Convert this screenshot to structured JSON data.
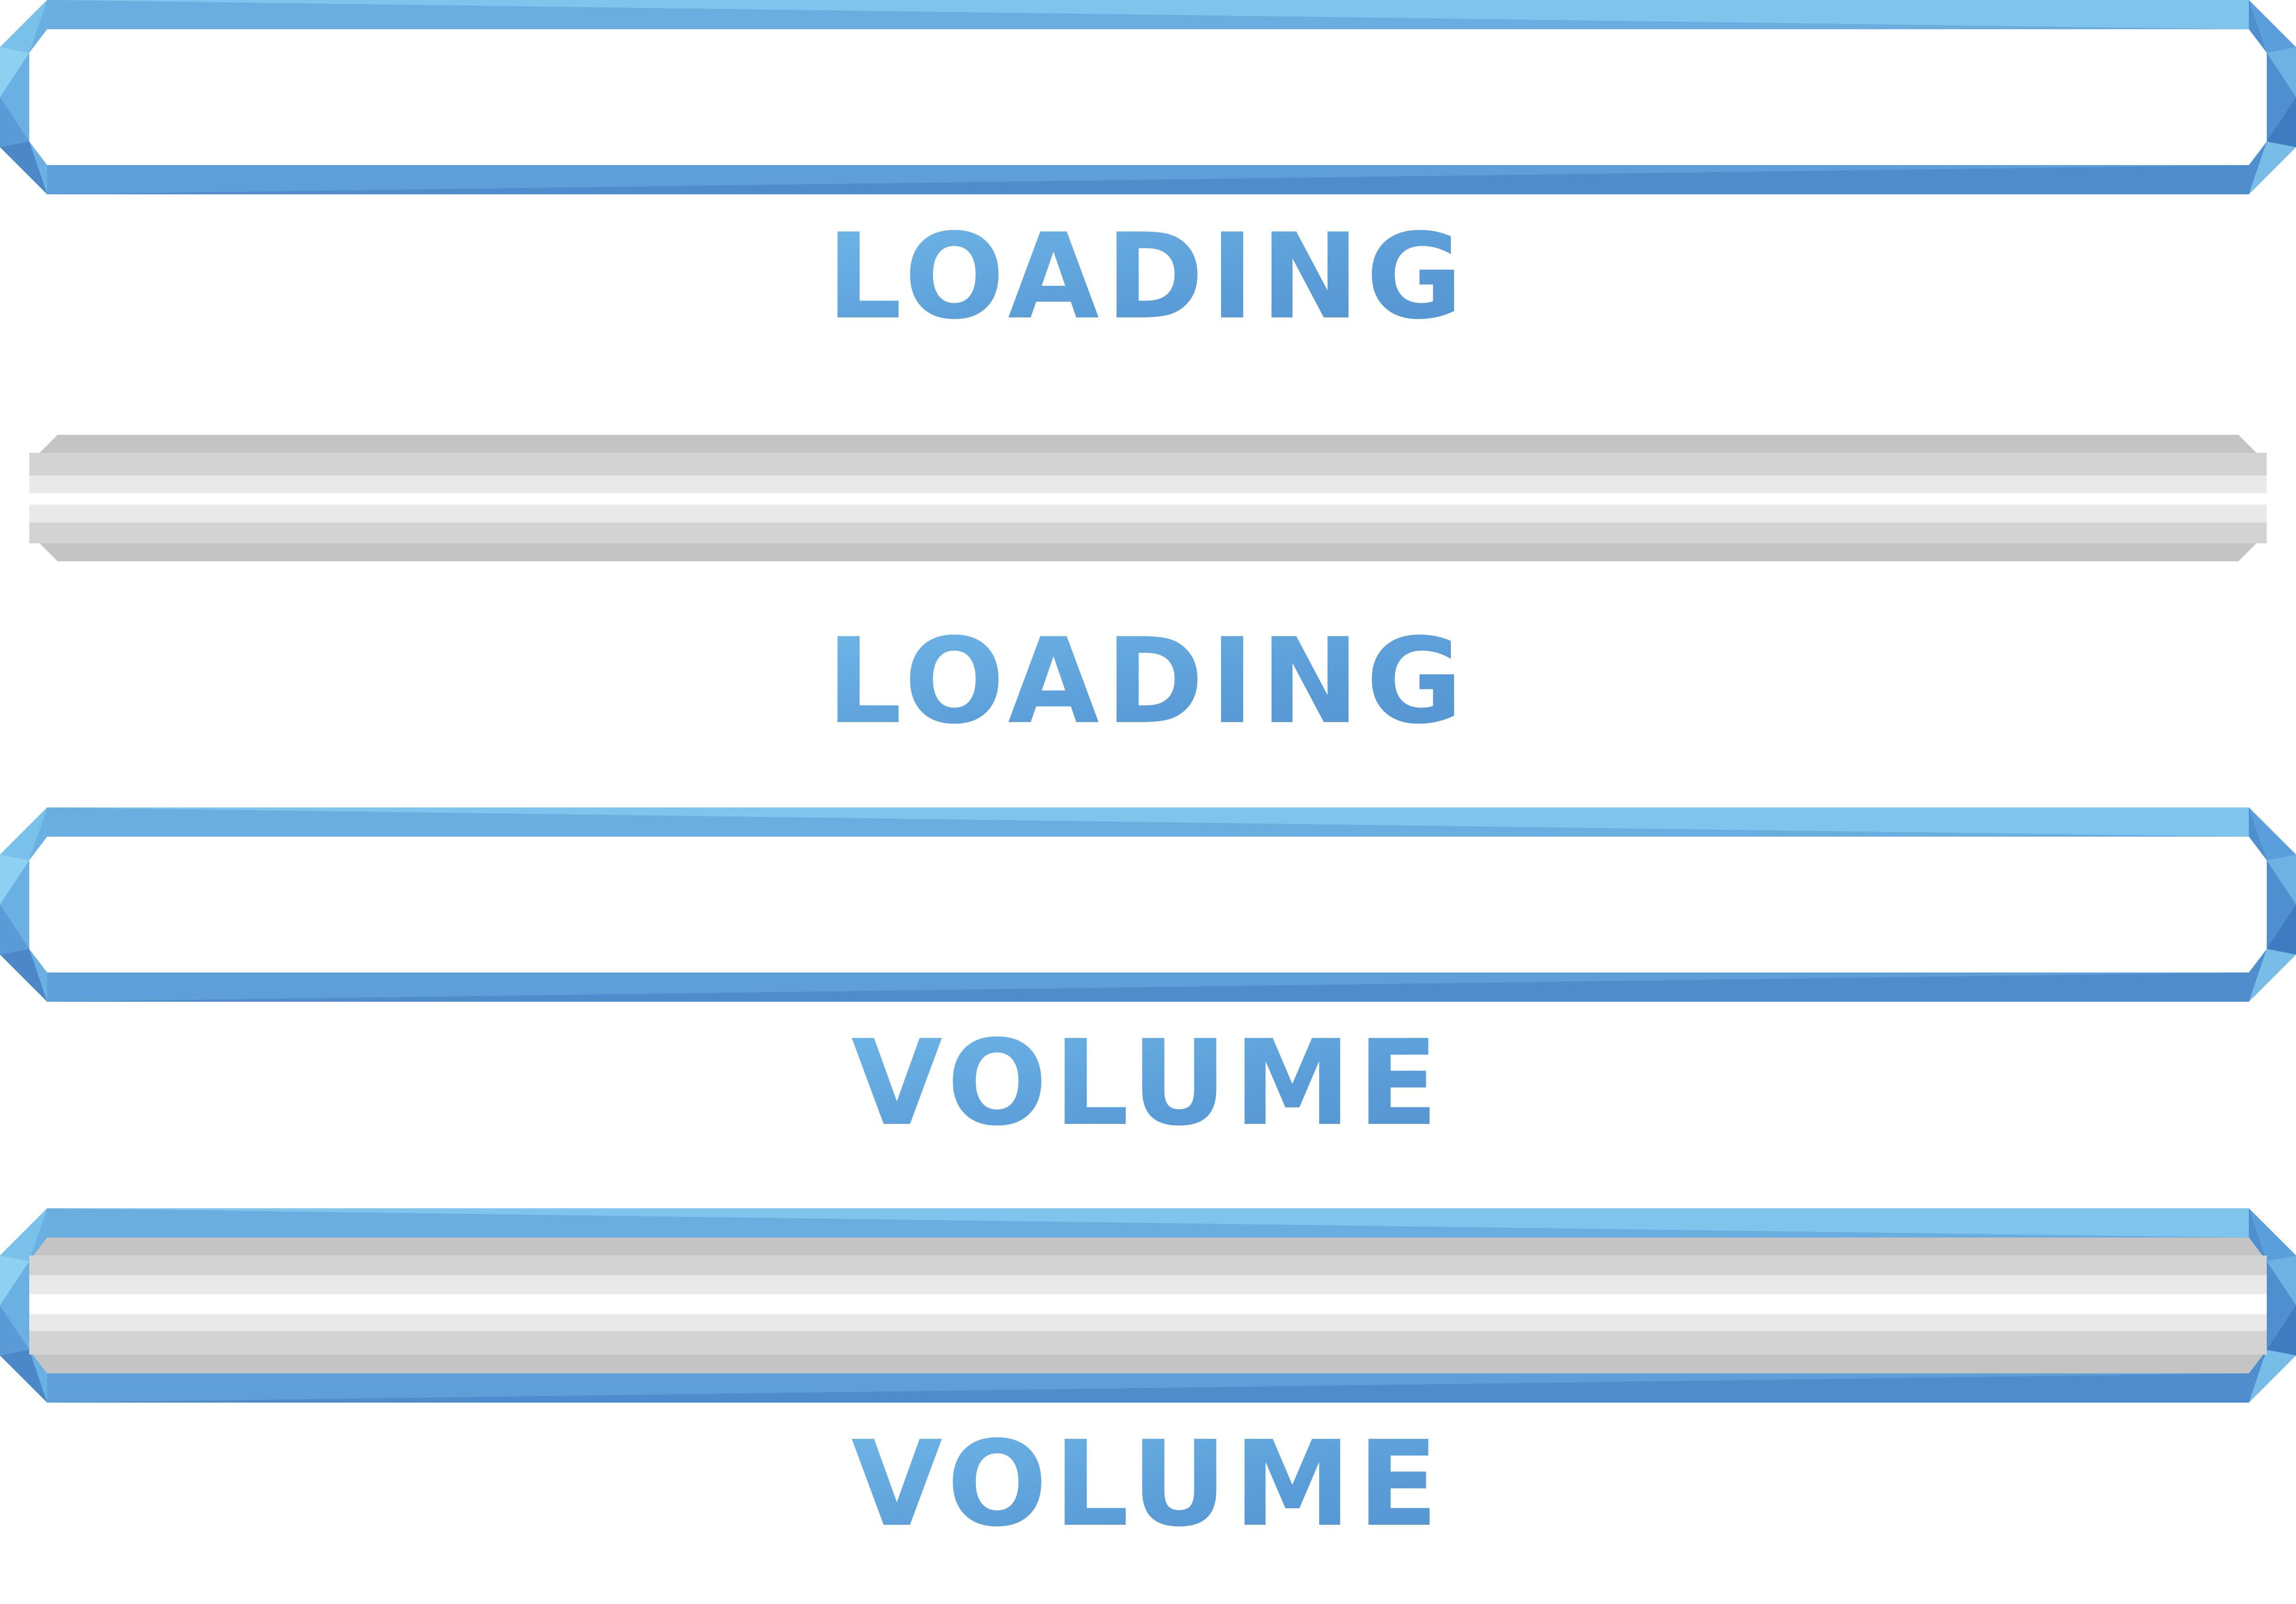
{
  "bars": [
    {
      "label": "LOADING",
      "style": "outline",
      "fill_fraction": 0
    },
    {
      "label": "LOADING",
      "style": "grey-track",
      "fill_fraction": 0
    },
    {
      "label": "VOLUME",
      "style": "outline",
      "fill_fraction": 0
    },
    {
      "label": "VOLUME",
      "style": "outline-with-grey-fill",
      "fill_fraction": 1
    }
  ],
  "colors": {
    "frame_light": "#7cc3ec",
    "frame_mid": "#62a5dc",
    "frame_dark": "#4c8bcb",
    "grey_dark": "#c4c4c4",
    "grey_mid": "#d3d3d3",
    "grey_light": "#e9e9e9",
    "white": "#ffffff"
  }
}
